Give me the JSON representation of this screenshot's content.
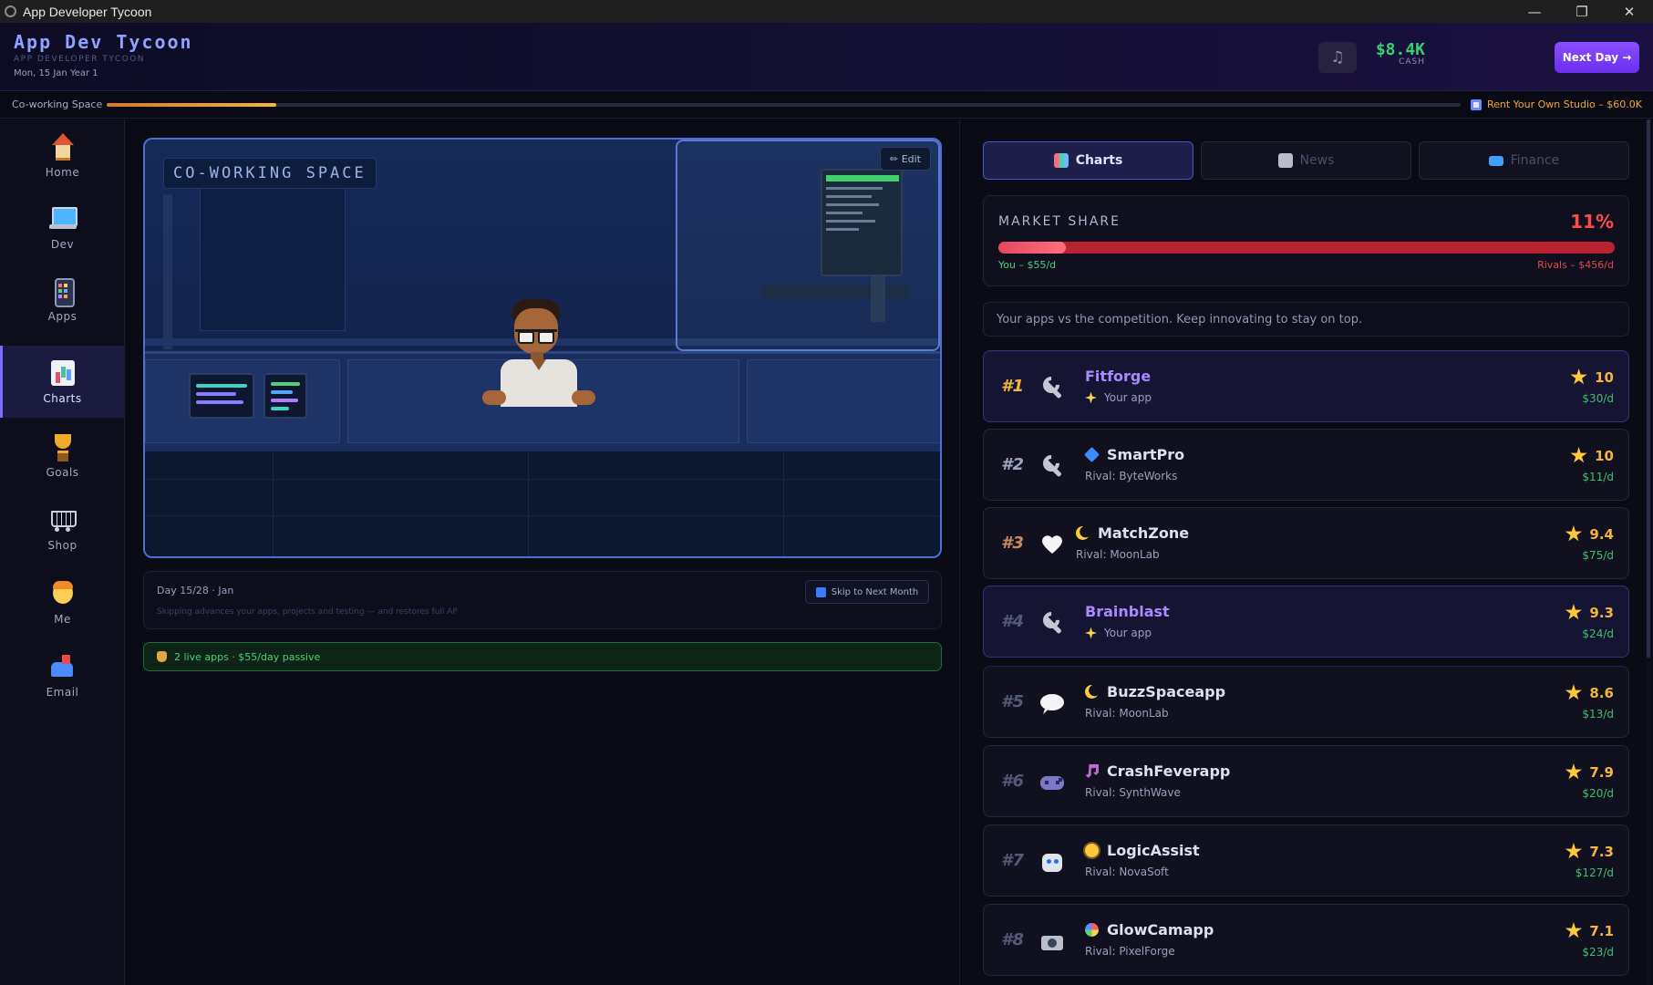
{
  "window": {
    "title": "App Developer Tycoon",
    "minimize": "—",
    "restore": "❐",
    "close": "✕"
  },
  "header": {
    "brand": "App Dev Tycoon",
    "subtitle": "APP DEVELOPER TYCOON",
    "date": "Mon, 15 Jan Year 1",
    "cash_value": "$8.4K",
    "cash_label": "CASH",
    "music_icon": "♫",
    "next_day_label": "Next Day →"
  },
  "progress": {
    "current_label": "Co-working Space",
    "fraction": 0.125,
    "goal_label": "Rent Your Own Studio – $60.0K"
  },
  "sidebar": {
    "active": "charts",
    "items": [
      {
        "id": "home",
        "label": "Home",
        "icon": "house-icon"
      },
      {
        "id": "dev",
        "label": "Dev",
        "icon": "laptop-icon"
      },
      {
        "id": "apps",
        "label": "Apps",
        "icon": "phone-icon"
      },
      {
        "id": "charts",
        "label": "Charts",
        "icon": "bar-chart-icon"
      },
      {
        "id": "goals",
        "label": "Goals",
        "icon": "trophy-icon"
      },
      {
        "id": "shop",
        "label": "Shop",
        "icon": "cart-icon"
      },
      {
        "id": "me",
        "label": "Me",
        "icon": "person-icon"
      },
      {
        "id": "email",
        "label": "Email",
        "icon": "mailbox-icon"
      }
    ]
  },
  "scene": {
    "sign": "CO-WORKING SPACE",
    "edit_label": "✏ Edit"
  },
  "day_panel": {
    "day_text": "Day 15/28 · Jan",
    "hint": "Skipping advances your apps, projects and testing — and restores full AP",
    "skip_label": "Skip to Next Month"
  },
  "passive": {
    "text": "2 live apps · $55/day passive"
  },
  "tabs": [
    {
      "id": "charts",
      "label": "Charts",
      "active": true,
      "icon": "chart-icon",
      "color": "#6fb6ff"
    },
    {
      "id": "news",
      "label": "News",
      "active": false,
      "icon": "newspaper-icon",
      "color": "#b9bccb"
    },
    {
      "id": "finance",
      "label": "Finance",
      "active": false,
      "icon": "card-icon",
      "color": "#3fa1ff"
    }
  ],
  "market": {
    "title": "MARKET SHARE",
    "percent_label": "11%",
    "share": 0.11,
    "you_label": "You – $55/d",
    "rivals_label": "Rivals – $456/d"
  },
  "intro": "Your apps vs the competition. Keep innovating to stay on top.",
  "rankings": [
    {
      "rank": "#1",
      "name": "Fitforge",
      "owner": "Your app",
      "mine": true,
      "icon": "wrench-icon",
      "glyph": "",
      "score": "10",
      "revenue": "$30/d"
    },
    {
      "rank": "#2",
      "name": "SmartPro",
      "owner": "Rival: ByteWorks",
      "mine": false,
      "icon": "wrench-icon",
      "glyph": "diamond-icon",
      "score": "10",
      "revenue": "$11/d"
    },
    {
      "rank": "#3",
      "name": "MatchZone",
      "owner": "Rival: MoonLab",
      "mine": false,
      "icon": "heart-icon",
      "glyph": "moon-icon",
      "score": "9.4",
      "revenue": "$75/d"
    },
    {
      "rank": "#4",
      "name": "Brainblast",
      "owner": "Your app",
      "mine": true,
      "icon": "wrench-icon",
      "glyph": "",
      "score": "9.3",
      "revenue": "$24/d"
    },
    {
      "rank": "#5",
      "name": "BuzzSpaceapp",
      "owner": "Rival: MoonLab",
      "mine": false,
      "icon": "speech-bubble-icon",
      "glyph": "moon-icon",
      "score": "8.6",
      "revenue": "$13/d"
    },
    {
      "rank": "#6",
      "name": "CrashFeverapp",
      "owner": "Rival: SynthWave",
      "mine": false,
      "icon": "gamepad-icon",
      "glyph": "music-note-icon",
      "score": "7.9",
      "revenue": "$20/d"
    },
    {
      "rank": "#7",
      "name": "LogicAssist",
      "owner": "Rival: NovaSoft",
      "mine": false,
      "icon": "robot-icon",
      "glyph": "sun-icon",
      "score": "7.3",
      "revenue": "$127/d"
    },
    {
      "rank": "#8",
      "name": "GlowCamapp",
      "owner": "Rival: PixelForge",
      "mine": false,
      "icon": "camera-icon",
      "glyph": "palette-icon",
      "score": "7.1",
      "revenue": "$23/d"
    }
  ]
}
